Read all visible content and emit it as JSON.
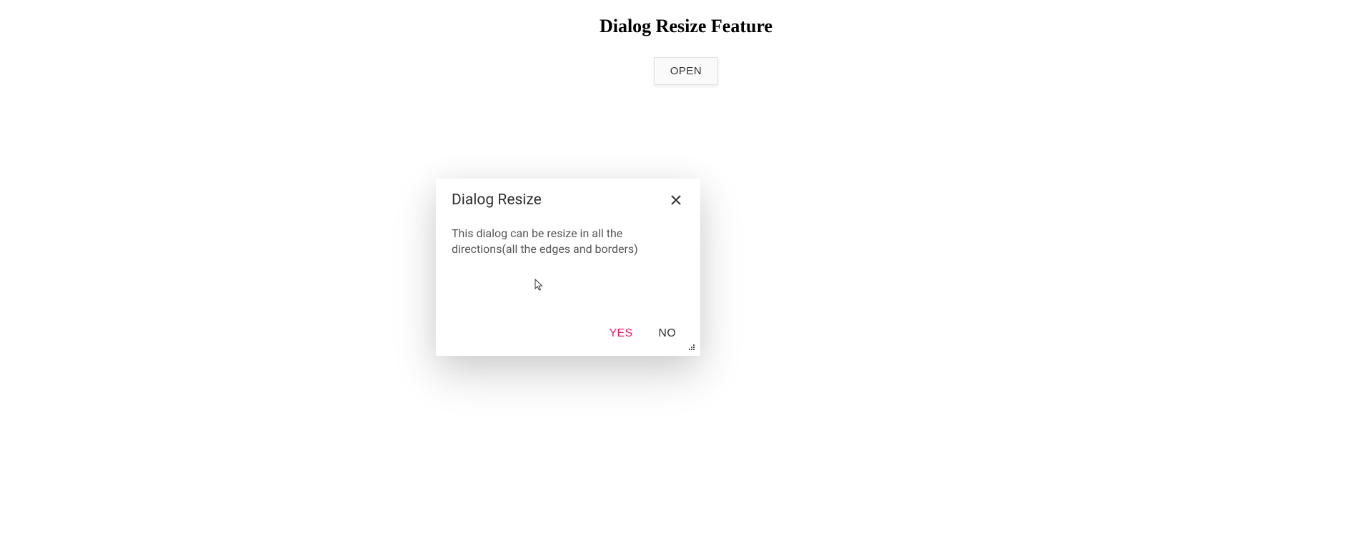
{
  "page": {
    "title": "Dialog Resize Feature",
    "open_button_label": "OPEN"
  },
  "dialog": {
    "title": "Dialog Resize",
    "body_text": "This dialog can be resize in all the directions(all the edges and borders)",
    "close_icon_name": "close-icon",
    "resize_handle_name": "resize-handle-icon",
    "buttons": {
      "yes_label": "YES",
      "no_label": "NO"
    }
  },
  "colors": {
    "accent": "#e91e63",
    "text": "#333333",
    "muted": "#555555",
    "surface": "#ffffff"
  }
}
